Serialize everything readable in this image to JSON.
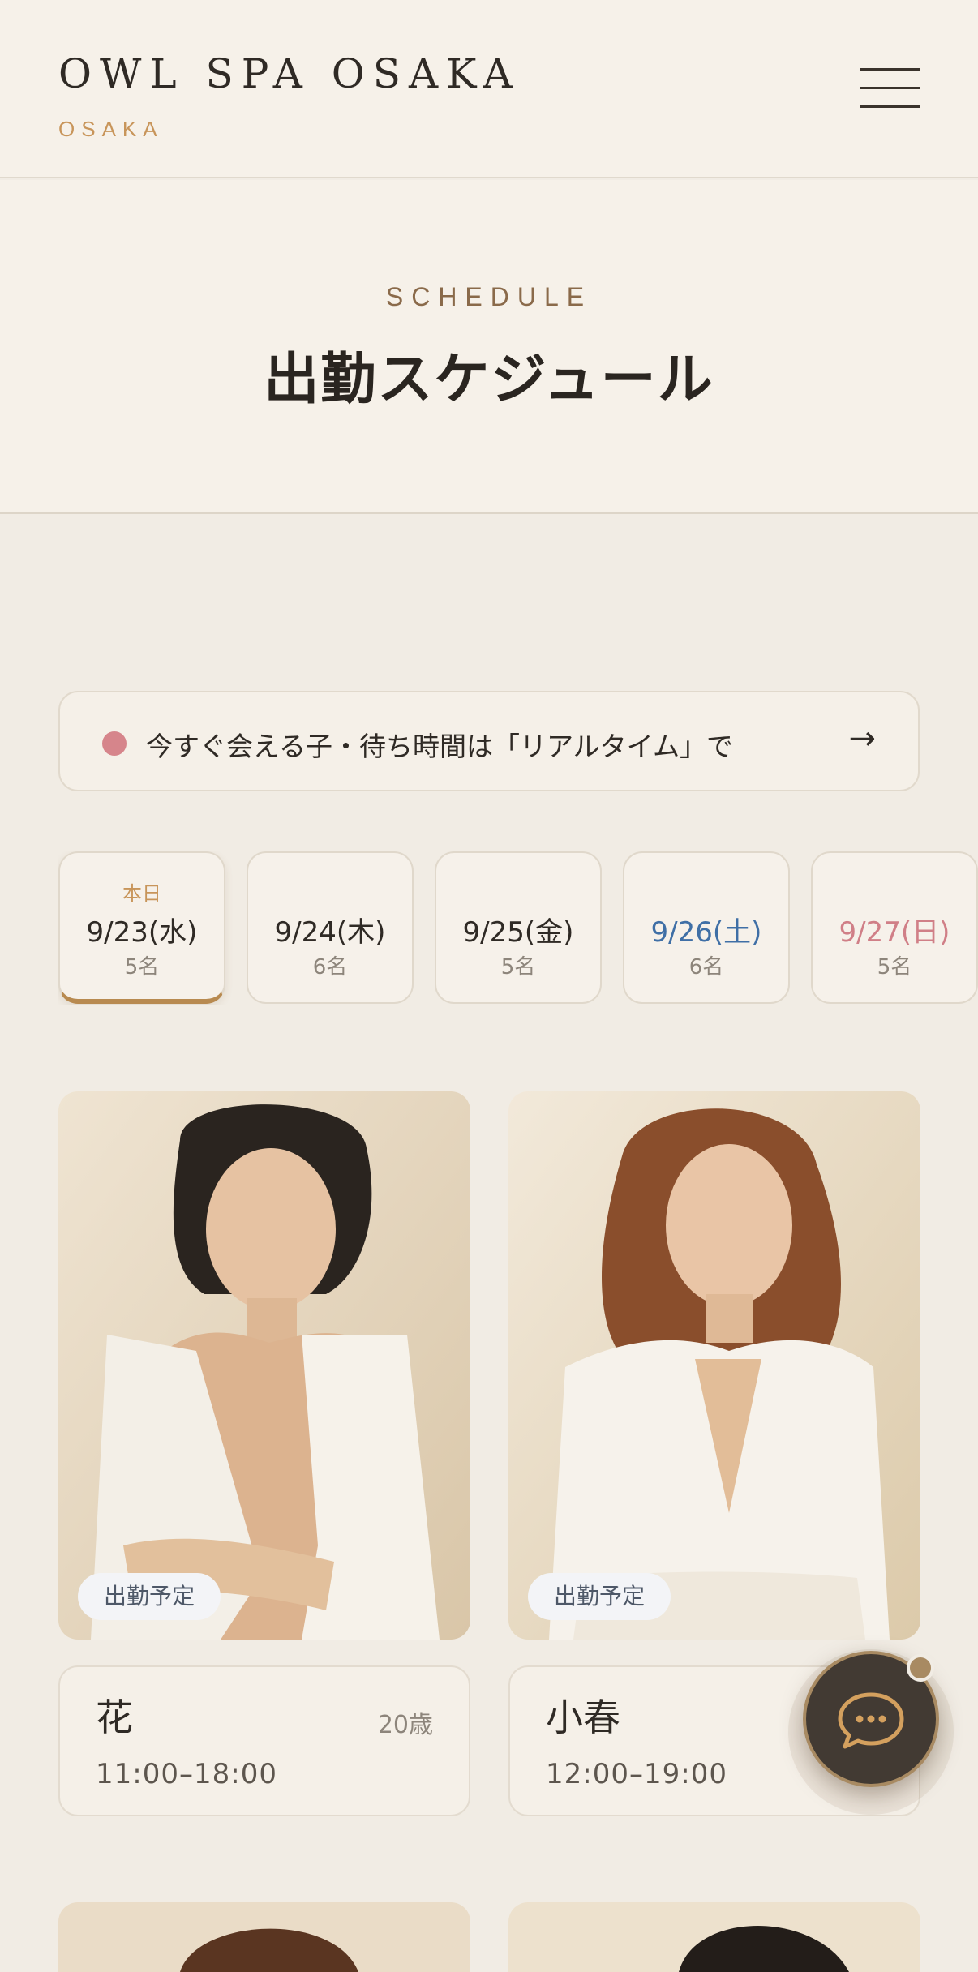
{
  "header": {
    "brand": "OWL SPA OSAKA",
    "brand_sub": "OSAKA"
  },
  "title_band": {
    "eyebrow": "SCHEDULE",
    "title": "出勤スケジュール"
  },
  "realtime": {
    "text": "今すぐ会える子・待ち時間は「リアルタイム」で",
    "arrow": "→",
    "dot_color": "#d6858b"
  },
  "date_tabs": [
    {
      "today_label": "本日",
      "date": "9/23(水)",
      "count": "5名",
      "color": "#2f2a25",
      "active": true
    },
    {
      "date": "9/24(木)",
      "count": "6名",
      "color": "#2f2a25"
    },
    {
      "date": "9/25(金)",
      "count": "5名",
      "color": "#2f2a25"
    },
    {
      "date": "9/26(土)",
      "count": "6名",
      "color": "#3f6fa6"
    },
    {
      "date": "9/27(日)",
      "count": "5名",
      "color": "#d07f87"
    }
  ],
  "casts": [
    {
      "badge": "出勤予定",
      "name": "花",
      "age": "20歳",
      "time": "11:00–18:00"
    },
    {
      "badge": "出勤予定",
      "name": "小春",
      "age": "",
      "time": "12:00–19:00"
    }
  ],
  "colors": {
    "accent": "#c8955a",
    "background": "#f1ece4",
    "fab": "#423a33"
  },
  "icons": {
    "menu": "hamburger-icon",
    "chat": "chat-bubble-icon"
  }
}
